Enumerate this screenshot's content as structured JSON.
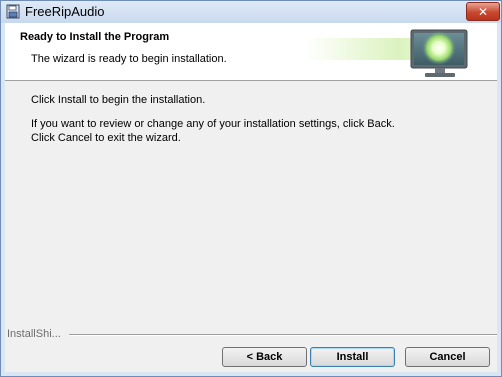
{
  "window": {
    "title": "FreeRipAudio",
    "close_glyph": "✕",
    "app_icon": "installer-disk-icon"
  },
  "header": {
    "title": "Ready to Install the Program",
    "subtitle": "The wizard is ready to begin installation.",
    "graphic": "monitor-icon"
  },
  "body": {
    "line_install": "Click Install to begin the installation.",
    "line_review": "If you want to review or change any of your installation settings, click Back.",
    "line_cancel": "Click Cancel to exit the wizard."
  },
  "footer": {
    "brand": "InstallShi..."
  },
  "buttons": {
    "back": "< Back",
    "install": "Install",
    "cancel": "Cancel"
  },
  "colors": {
    "title_bar": "#c9d9ee",
    "close_button": "#c8492f",
    "dialog_bg": "#f0f0f0",
    "header_bg": "#ffffff",
    "default_button_border": "#3c7fb1"
  }
}
